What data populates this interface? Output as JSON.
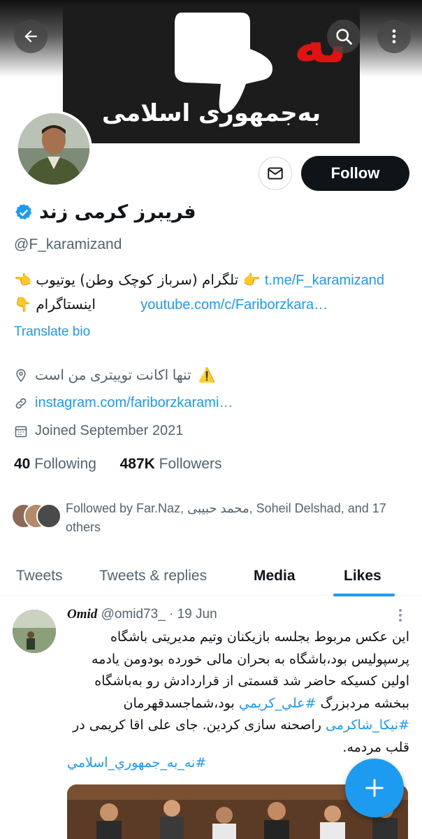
{
  "banner": {
    "big_word": "نه",
    "slogan": "به‌جمهوری اسلامی",
    "colors": {
      "bg": "#1c1c1c",
      "accent": "#e01313"
    }
  },
  "toolbar": {
    "back_icon": "arrow-left-icon",
    "search_icon": "search-icon",
    "more_icon": "more-vertical-icon"
  },
  "profile": {
    "display_name": "فریبرز کرمی زند",
    "verified": true,
    "handle": "@F_karamizand",
    "follow_label": "Follow",
    "message_icon": "envelope-icon",
    "bio_line1_text": "تلگرام  (سرباز کوچک وطن)  یوتیوب",
    "bio_line1_link": "t.me/F_karamizand",
    "bio_line2_text": "اینستاگرام",
    "bio_line2_link": "youtube.com/c/Fariborzkara…",
    "translate_label": "Translate bio",
    "location": "تنها اکانت توییتری من است",
    "website": "instagram.com/fariborzkarami…",
    "joined": "Joined September 2021",
    "following_count": "40",
    "following_label": "Following",
    "followers_count": "487K",
    "followers_label": "Followers",
    "followed_by": "Followed by Far.Naz, محمد حبیبی, Soheil Delshad, and 17 others"
  },
  "tabs": [
    {
      "label": "Tweets"
    },
    {
      "label": "Tweets & replies"
    },
    {
      "label": "Media"
    },
    {
      "label": "Likes",
      "active": true
    }
  ],
  "tweet": {
    "author": "Omid",
    "handle_date": "@omid73_ · 19 Jun",
    "line1": "این عکس مربوط بجلسه بازیکنان وتیم مدیریتی باشگاه",
    "line2": "پرسپولیس بود،باشگاه به بحران مالی خورده بودومن یادمه",
    "line3": "اولین کسیکه حاضر شد قسمتی از قراردادش رو به‌باشگاه",
    "line4_text": "ببخشه مردبزرگ ",
    "line4_tag": "#علي_كريمي",
    "line4_end": " بود،شماجسدقهرمان",
    "line5_tag": "#نیکا_شاکرمی",
    "line5_text": " راصحنه سازی کردین. جای علی اقا کریمی در",
    "line6": "قلب مردمه.",
    "hashtag_line": "#نه_به_جمهوري_اسلامي"
  },
  "fab": {
    "icon": "plus-icon"
  },
  "colors": {
    "accent": "#1d9bf0",
    "text": "#0f1419",
    "muted": "#536471"
  }
}
